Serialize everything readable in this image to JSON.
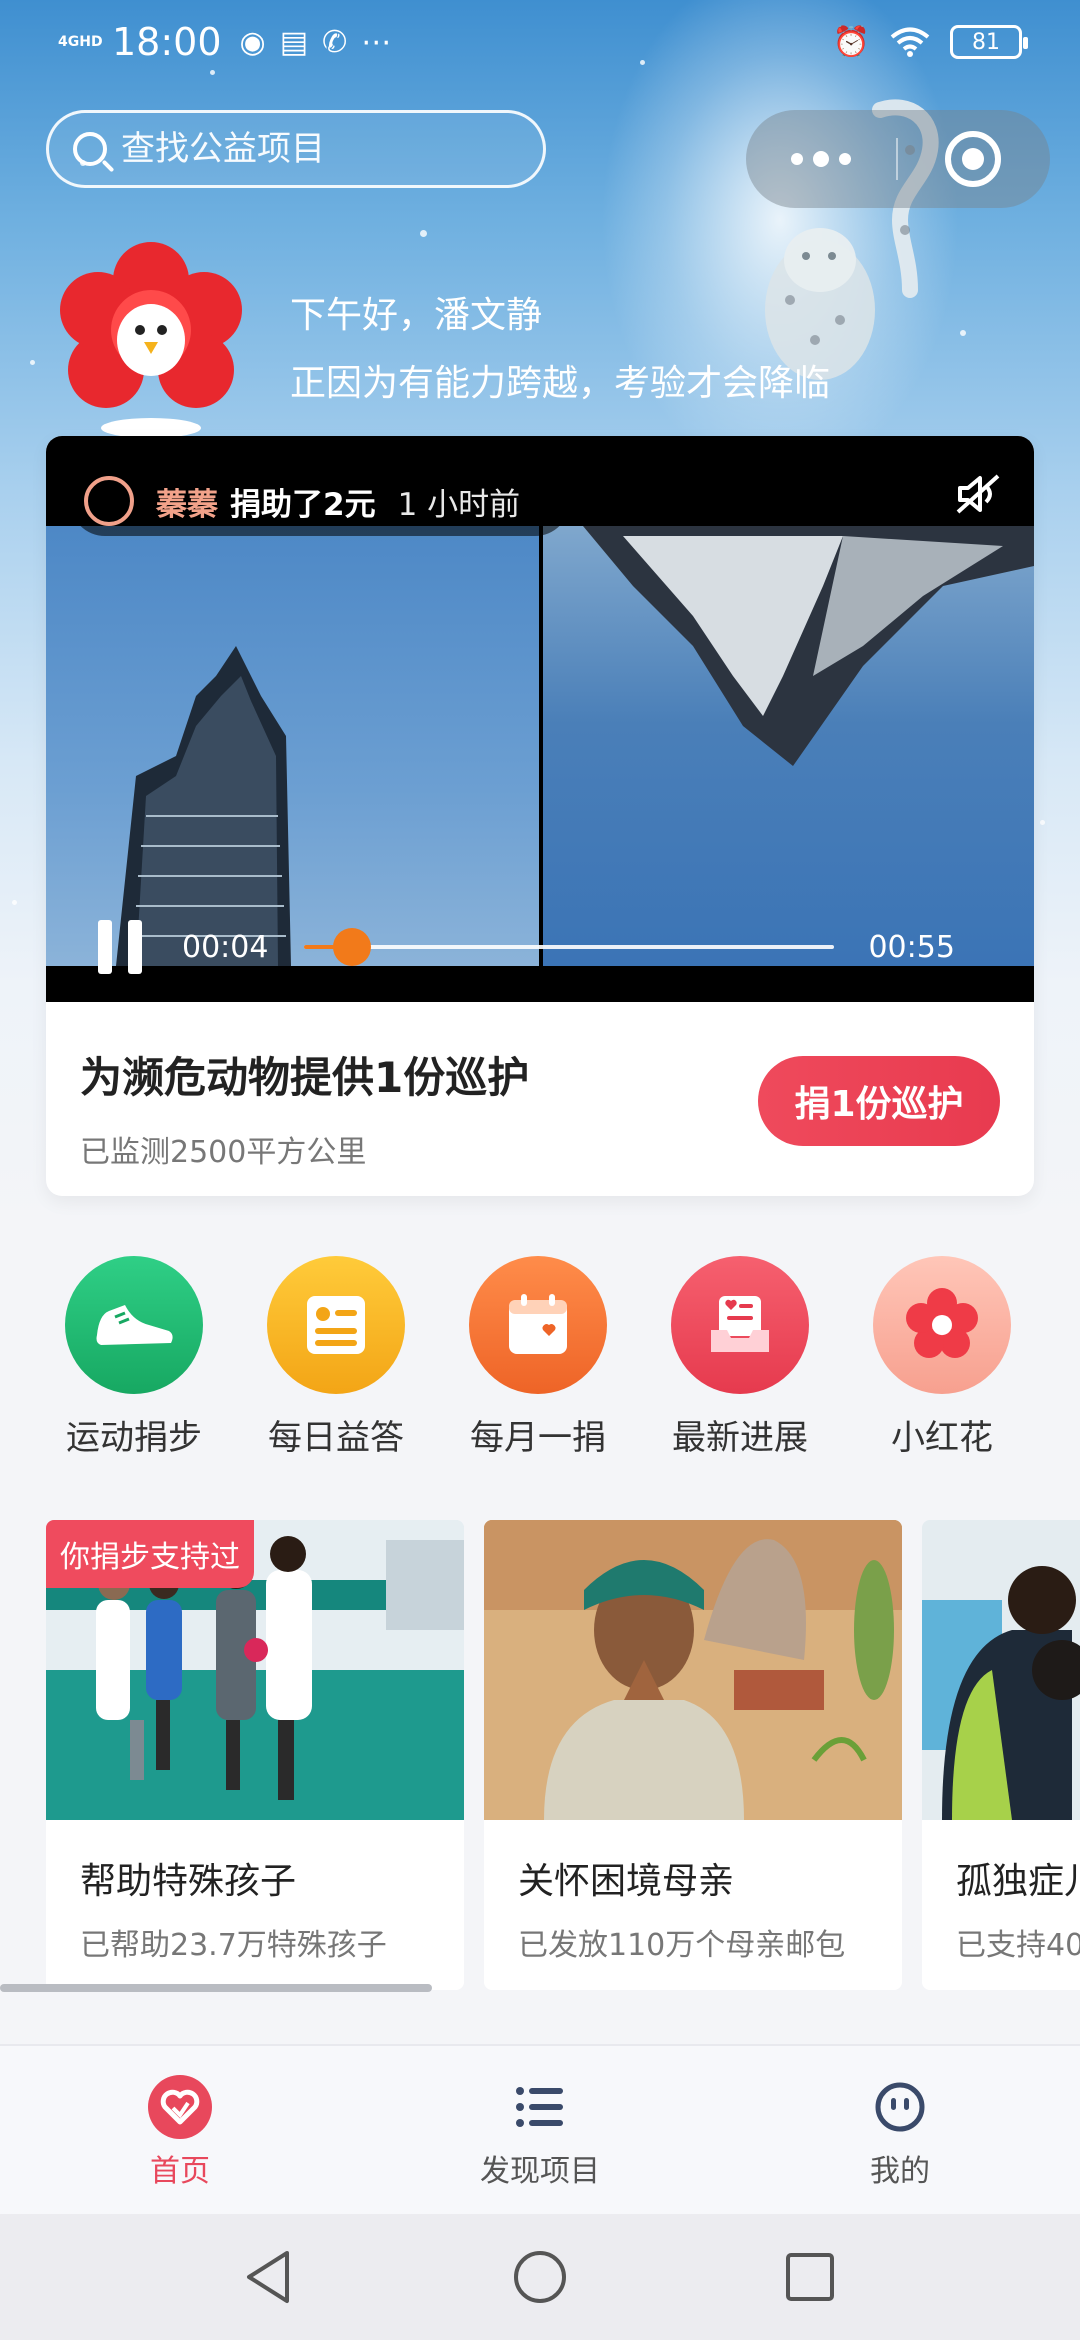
{
  "status_bar": {
    "network": "4GHD",
    "time": "18:00",
    "icons": [
      "voice-icon",
      "message-icon",
      "call-icon",
      "more-dots-icon",
      "alarm-icon",
      "wifi-icon"
    ],
    "battery": "81"
  },
  "search": {
    "placeholder": "查找公益项目"
  },
  "greeting": {
    "line1": "下午好，潘文静",
    "line2": "正因为有能力跨越，考验才会降临"
  },
  "video": {
    "donor_name": "蓁蓁",
    "donation_text": "捐助了2元",
    "time_ago": "1 小时前",
    "current_time": "00:04",
    "total_time": "00:55",
    "progress_fraction": 0.09,
    "state": "playing",
    "muted": true
  },
  "feature": {
    "title": "为濒危动物提供1份巡护",
    "subtitle": "已监测2500平方公里",
    "button": "捐1份巡护"
  },
  "quick_actions": [
    {
      "label": "运动捐步",
      "icon": "sneaker-icon",
      "color": "#22b573"
    },
    {
      "label": "每日益答",
      "icon": "quiz-card-icon",
      "color": "#f5b21c"
    },
    {
      "label": "每月一捐",
      "icon": "calendar-heart-icon",
      "color": "#f2773a"
    },
    {
      "label": "最新进展",
      "icon": "news-tray-icon",
      "color": "#ec4a5b"
    },
    {
      "label": "小红花",
      "icon": "red-flower-icon",
      "color": "#f7a99a"
    }
  ],
  "projects": [
    {
      "tag": "你捐步支持过",
      "title": "帮助特殊孩子",
      "subtitle": "已帮助23.7万特殊孩子"
    },
    {
      "tag": "",
      "title": "关怀困境母亲",
      "subtitle": "已发放110万个母亲邮包"
    },
    {
      "tag": "",
      "title": "孤独症儿",
      "subtitle": "已支持40"
    }
  ],
  "tabs": [
    {
      "label": "首页",
      "icon": "heart-home-icon",
      "active": true
    },
    {
      "label": "发现项目",
      "icon": "list-icon",
      "active": false
    },
    {
      "label": "我的",
      "icon": "smile-face-icon",
      "active": false
    }
  ],
  "colors": {
    "accent": "#e8485c",
    "progress": "#f27a1a"
  }
}
